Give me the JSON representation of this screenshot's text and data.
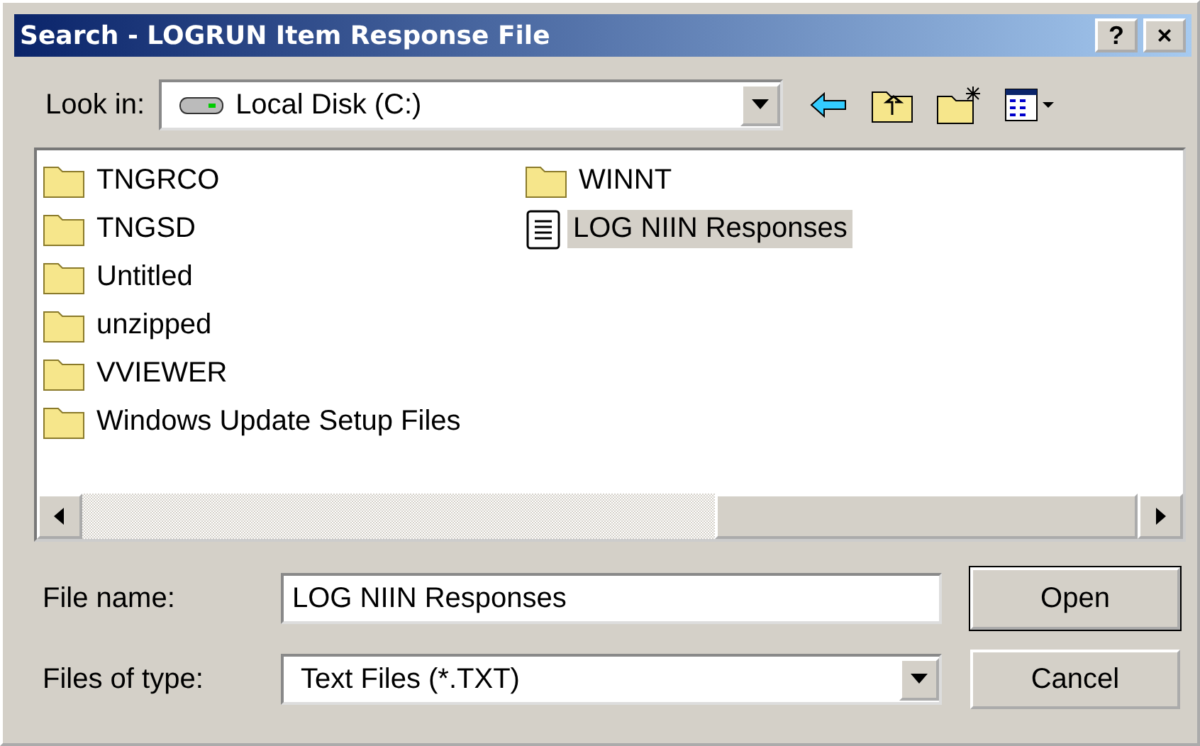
{
  "window": {
    "title": "Search - LOGRUN Item Response File",
    "buttons": [
      "?",
      "×"
    ]
  },
  "look_in": {
    "label": "Look in:",
    "value": "Local Disk (C:)"
  },
  "files": {
    "columns": [
      [
        {
          "name": "TNGRCO",
          "kind": "folder",
          "selected": false
        },
        {
          "name": "TNGSD",
          "kind": "folder",
          "selected": false
        },
        {
          "name": "Untitled",
          "kind": "folder",
          "selected": false
        },
        {
          "name": "unzipped",
          "kind": "folder",
          "selected": false
        },
        {
          "name": "VVIEWER",
          "kind": "folder",
          "selected": false
        },
        {
          "name": "Windows Update Setup Files",
          "kind": "folder",
          "selected": false
        }
      ],
      [
        {
          "name": "WINNT",
          "kind": "folder",
          "selected": false
        },
        {
          "name": "LOG NIIN Responses",
          "kind": "text",
          "selected": true
        }
      ]
    ]
  },
  "file_name": {
    "label": "File name:",
    "value": "LOG NIIN Responses"
  },
  "file_type": {
    "label": "Files of type:",
    "value": "Text Files (*.TXT)"
  },
  "buttons": [
    "Open",
    "Cancel"
  ]
}
